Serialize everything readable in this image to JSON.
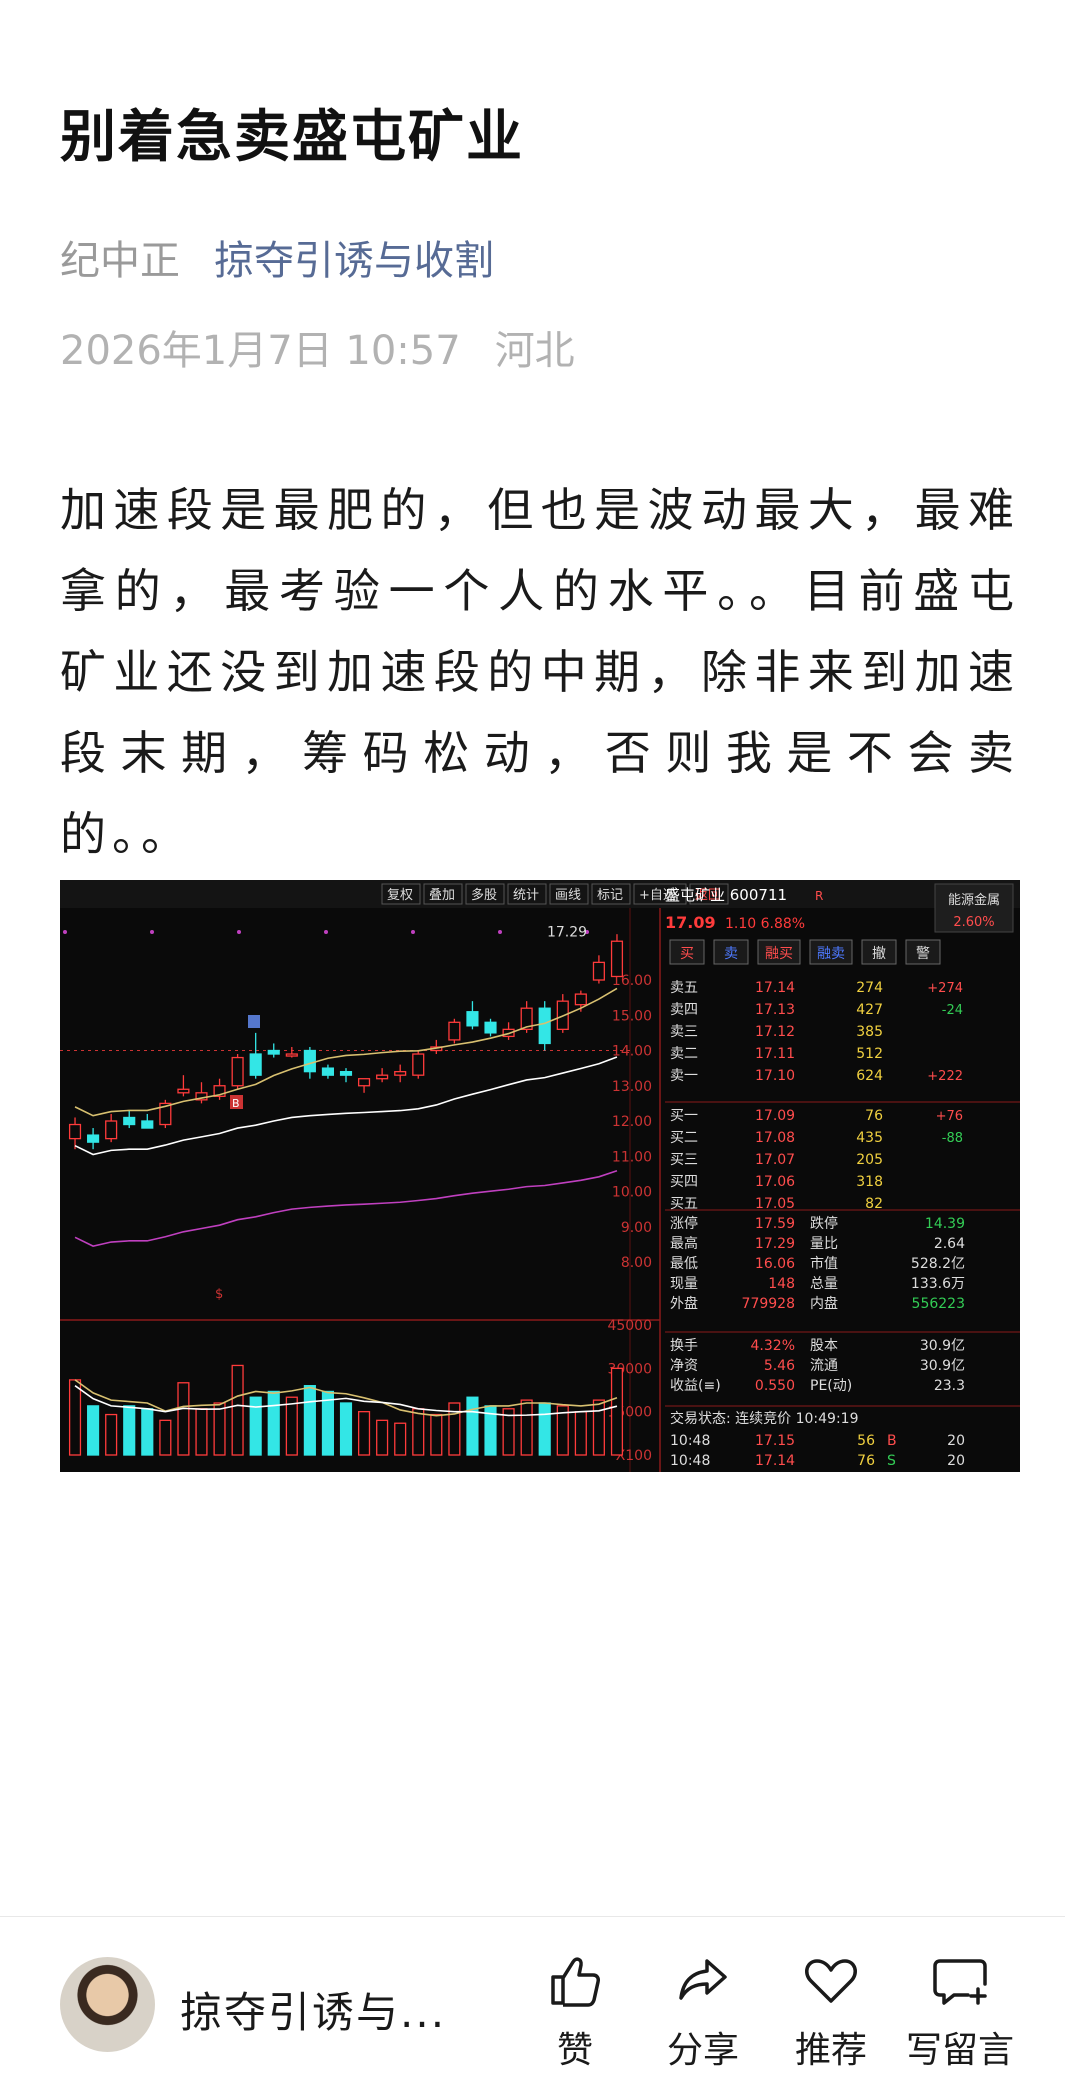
{
  "article": {
    "title": "别着急卖盛屯矿业",
    "author_name": "纪中正",
    "account_name": "掠夺引诱与收割",
    "datetime": "2026年1月7日 10:57",
    "location": "河北",
    "body": "加速段是最肥的，但也是波动最大，最难拿的，最考验一个人的水平。。目前盛屯矿业还没到加速段的中期，除非来到加速段末期，筹码松动，否则我是不会卖的。。"
  },
  "chart": {
    "toolbar": [
      "复权",
      "叠加",
      "多股",
      "统计",
      "画线",
      "标记",
      "+自选",
      "返回"
    ],
    "stock_name": "盛屯矿业",
    "stock_code": "600711",
    "r_tag": "R",
    "sector": "能源金属",
    "sector_pct": "2.60%",
    "price": "17.09",
    "change": "1.10",
    "change_pct": "6.88%",
    "high_label": "17.29",
    "price_axis": [
      "16.00",
      "15.00",
      "14.00",
      "13.00",
      "12.00",
      "11.00",
      "10.00",
      "9.00",
      "8.00"
    ],
    "vol_axis": [
      "45000",
      "30000",
      "15000",
      "X100"
    ],
    "trade_buttons": [
      "买",
      "卖",
      "融买",
      "融卖",
      "撤",
      "警"
    ],
    "asks": [
      {
        "label": "卖五",
        "price": "17.14",
        "vol": "274",
        "chg": "+274"
      },
      {
        "label": "卖四",
        "price": "17.13",
        "vol": "427",
        "chg": "-24"
      },
      {
        "label": "卖三",
        "price": "17.12",
        "vol": "385",
        "chg": ""
      },
      {
        "label": "卖二",
        "price": "17.11",
        "vol": "512",
        "chg": ""
      },
      {
        "label": "卖一",
        "price": "17.10",
        "vol": "624",
        "chg": "+222"
      }
    ],
    "bids": [
      {
        "label": "买一",
        "price": "17.09",
        "vol": "76",
        "chg": "+76"
      },
      {
        "label": "买二",
        "price": "17.08",
        "vol": "435",
        "chg": "-88"
      },
      {
        "label": "买三",
        "price": "17.07",
        "vol": "205",
        "chg": ""
      },
      {
        "label": "买四",
        "price": "17.06",
        "vol": "318",
        "chg": ""
      },
      {
        "label": "买五",
        "price": "17.05",
        "vol": "82",
        "chg": ""
      }
    ],
    "stats": [
      {
        "l1": "涨停",
        "v1": "17.59",
        "l2": "跌停",
        "v2": "14.39"
      },
      {
        "l1": "最高",
        "v1": "17.29",
        "l2": "量比",
        "v2": "2.64"
      },
      {
        "l1": "最低",
        "v1": "16.06",
        "l2": "市值",
        "v2": "528.2亿"
      },
      {
        "l1": "现量",
        "v1": "148",
        "l2": "总量",
        "v2": "133.6万"
      },
      {
        "l1": "外盘",
        "v1": "779928",
        "l2": "内盘",
        "v2": "556223"
      }
    ],
    "stats2": [
      {
        "l1": "换手",
        "v1": "4.32%",
        "l2": "股本",
        "v2": "30.9亿"
      },
      {
        "l1": "净资",
        "v1": "5.46",
        "l2": "流通",
        "v2": "30.9亿"
      },
      {
        "l1": "收益(≡)",
        "v1": "0.550",
        "l2": "PE(动)",
        "v2": "23.3"
      }
    ],
    "trade_status": "交易状态: 连续竞价 10:49:19",
    "ticks": [
      {
        "time": "10:48",
        "price": "17.15",
        "vol": "56",
        "side": "B",
        "n": "20"
      },
      {
        "time": "10:48",
        "price": "17.14",
        "vol": "76",
        "side": "S",
        "n": "20"
      }
    ],
    "candles": [
      {
        "o": 11.5,
        "h": 12.1,
        "l": 11.2,
        "c": 11.9,
        "vol": 26000
      },
      {
        "o": 11.6,
        "h": 11.8,
        "l": 11.2,
        "c": 11.4,
        "vol": 17000
      },
      {
        "o": 11.5,
        "h": 12.2,
        "l": 11.4,
        "c": 12.0,
        "vol": 14000
      },
      {
        "o": 12.1,
        "h": 12.3,
        "l": 11.8,
        "c": 11.9,
        "vol": 17000
      },
      {
        "o": 12.0,
        "h": 12.2,
        "l": 11.8,
        "c": 11.8,
        "vol": 16000
      },
      {
        "o": 11.9,
        "h": 12.6,
        "l": 11.8,
        "c": 12.5,
        "vol": 12000
      },
      {
        "o": 12.8,
        "h": 13.3,
        "l": 12.7,
        "c": 12.9,
        "vol": 25000
      },
      {
        "o": 12.6,
        "h": 13.1,
        "l": 12.5,
        "c": 12.8,
        "vol": 16000
      },
      {
        "o": 12.7,
        "h": 13.2,
        "l": 12.6,
        "c": 13.0,
        "vol": 18000
      },
      {
        "o": 13.0,
        "h": 13.9,
        "l": 12.9,
        "c": 13.8,
        "vol": 31000
      },
      {
        "o": 13.9,
        "h": 14.5,
        "l": 13.2,
        "c": 13.3,
        "vol": 20000
      },
      {
        "o": 14.0,
        "h": 14.2,
        "l": 13.8,
        "c": 13.9,
        "vol": 22000
      },
      {
        "o": 13.9,
        "h": 14.1,
        "l": 13.8,
        "c": 13.9,
        "vol": 20000
      },
      {
        "o": 14.0,
        "h": 14.1,
        "l": 13.2,
        "c": 13.4,
        "vol": 24000
      },
      {
        "o": 13.5,
        "h": 13.6,
        "l": 13.2,
        "c": 13.3,
        "vol": 22000
      },
      {
        "o": 13.4,
        "h": 13.5,
        "l": 13.1,
        "c": 13.3,
        "vol": 18000
      },
      {
        "o": 13.0,
        "h": 13.2,
        "l": 12.8,
        "c": 13.2,
        "vol": 15000
      },
      {
        "o": 13.2,
        "h": 13.5,
        "l": 13.1,
        "c": 13.3,
        "vol": 12000
      },
      {
        "o": 13.3,
        "h": 13.6,
        "l": 13.1,
        "c": 13.4,
        "vol": 11000
      },
      {
        "o": 13.3,
        "h": 14.0,
        "l": 13.2,
        "c": 13.9,
        "vol": 16000
      },
      {
        "o": 14.0,
        "h": 14.3,
        "l": 13.9,
        "c": 14.1,
        "vol": 14000
      },
      {
        "o": 14.3,
        "h": 14.9,
        "l": 14.2,
        "c": 14.8,
        "vol": 18000
      },
      {
        "o": 15.1,
        "h": 15.4,
        "l": 14.6,
        "c": 14.7,
        "vol": 20000
      },
      {
        "o": 14.8,
        "h": 14.9,
        "l": 14.4,
        "c": 14.5,
        "vol": 17000
      },
      {
        "o": 14.4,
        "h": 14.8,
        "l": 14.3,
        "c": 14.6,
        "vol": 16000
      },
      {
        "o": 14.6,
        "h": 15.4,
        "l": 14.5,
        "c": 15.2,
        "vol": 19000
      },
      {
        "o": 15.2,
        "h": 15.4,
        "l": 14.0,
        "c": 14.2,
        "vol": 18000
      },
      {
        "o": 14.6,
        "h": 15.6,
        "l": 14.5,
        "c": 15.4,
        "vol": 17000
      },
      {
        "o": 15.3,
        "h": 15.7,
        "l": 15.1,
        "c": 15.6,
        "vol": 15000
      },
      {
        "o": 16.0,
        "h": 16.7,
        "l": 15.9,
        "c": 16.5,
        "vol": 19000
      },
      {
        "o": 16.1,
        "h": 17.3,
        "l": 16.1,
        "c": 17.1,
        "vol": 30000
      }
    ]
  },
  "bottom": {
    "author_short": "掠夺引诱与...",
    "like": "赞",
    "share": "分享",
    "recommend": "推荐",
    "comment": "写留言"
  },
  "colors": {
    "up": "#ff3b3b",
    "down": "#33e6e6",
    "link": "#576b95"
  }
}
